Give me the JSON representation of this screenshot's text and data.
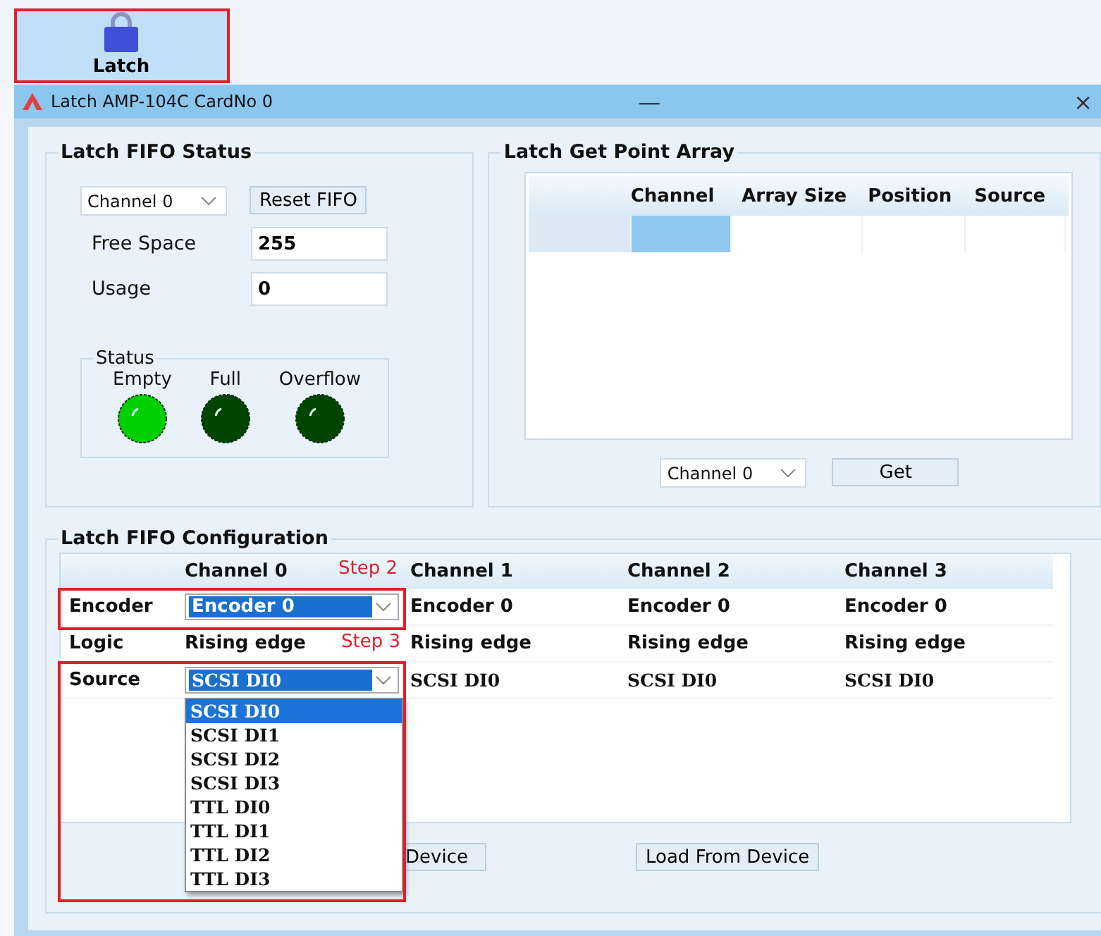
{
  "toolbar": {
    "buttons": [
      {
        "label": "Latch",
        "selected": true
      }
    ]
  },
  "window": {
    "title": "Latch AMP-104C CardNo 0",
    "controls": [
      "—",
      "×"
    ]
  },
  "fifo_status": {
    "title": "Latch FIFO Status",
    "channel_select": "Channel 0",
    "reset_button": "Reset FIFO",
    "fields": [
      {
        "label": "Free Space",
        "value": "255"
      },
      {
        "label": "Usage",
        "value": "0"
      }
    ],
    "status": {
      "title": "Status",
      "leds": [
        {
          "label": "Empty",
          "on": true
        },
        {
          "label": "Full",
          "on": false
        },
        {
          "label": "Overflow",
          "on": false
        }
      ]
    }
  },
  "get_point_array": {
    "title": "Latch Get Point Array",
    "table": {
      "columns": [
        "Channel",
        "Array Size",
        "Position",
        "Source"
      ]
    },
    "channel_select": "Channel 0",
    "get_button": "Get"
  },
  "fifo_config": {
    "title": "Latch FIFO Configuration",
    "columns": [
      "Channel 0",
      "Channel 1",
      "Channel 2",
      "Channel 3"
    ],
    "rows": [
      {
        "label": "Encoder",
        "cells": [
          {
            "kind": "combo",
            "text": "Encoder 0"
          },
          {
            "kind": "text",
            "text": "Encoder 0"
          },
          {
            "kind": "text",
            "text": "Encoder 0"
          },
          {
            "kind": "text",
            "text": "Encoder 0"
          }
        ]
      },
      {
        "label": "Logic",
        "cells": [
          {
            "kind": "text",
            "text": "Rising edge"
          },
          {
            "kind": "text",
            "text": "Rising edge"
          },
          {
            "kind": "text",
            "text": "Rising edge"
          },
          {
            "kind": "text",
            "text": "Rising edge"
          }
        ]
      },
      {
        "label": "Source",
        "cells": [
          {
            "kind": "combo",
            "text": "SCSI DI0"
          },
          {
            "kind": "text",
            "text": "SCSI DI0"
          },
          {
            "kind": "text",
            "text": "SCSI DI0"
          },
          {
            "kind": "text",
            "text": "SCSI DI0"
          }
        ]
      }
    ],
    "source_dropdown": {
      "options": [
        {
          "label": "SCSI DI0",
          "selected": true
        },
        {
          "label": "SCSI DI1",
          "selected": false
        },
        {
          "label": "SCSI DI2",
          "selected": false
        },
        {
          "label": "SCSI DI3",
          "selected": false
        },
        {
          "label": "TTL DI0",
          "selected": false
        },
        {
          "label": "TTL DI1",
          "selected": false
        },
        {
          "label": "TTL DI2",
          "selected": false
        },
        {
          "label": "TTL DI3",
          "selected": false
        }
      ]
    },
    "steps": [
      "Step 2",
      "Step 3"
    ],
    "buttons": [
      "Device",
      "Load From Device"
    ]
  }
}
